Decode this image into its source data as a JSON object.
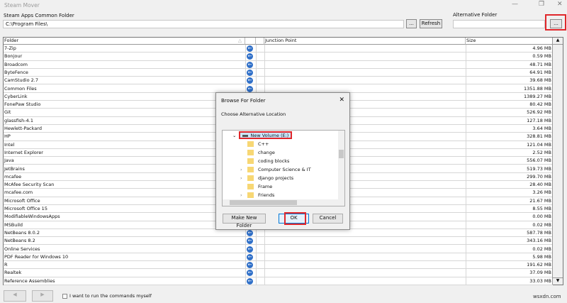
{
  "window": {
    "title": "Steam Mover",
    "min": "—",
    "restore": "❐",
    "close": "✕"
  },
  "steam": {
    "label": "Steam Apps Common Folder",
    "value": "C:\\Program Files\\",
    "browse": "...",
    "refresh": "Refresh"
  },
  "alt": {
    "label": "Alternative Folder",
    "value": "",
    "browse": "..."
  },
  "table": {
    "headers": {
      "folder": "Folder",
      "junction": "Junction Point",
      "size": "Size"
    },
    "rows": [
      {
        "folder": "7-Zip",
        "size": "4.96 MB"
      },
      {
        "folder": "Bonjour",
        "size": "0.59 MB"
      },
      {
        "folder": "Broadcom",
        "size": "48.71 MB"
      },
      {
        "folder": "ByteFence",
        "size": "64.91 MB"
      },
      {
        "folder": "CamStudio 2.7",
        "size": "39.68 MB"
      },
      {
        "folder": "Common Files",
        "size": "1351.88 MB"
      },
      {
        "folder": "CyberLink",
        "size": "1389.27 MB"
      },
      {
        "folder": "FonePaw Studio",
        "size": "80.42 MB"
      },
      {
        "folder": "Git",
        "size": "526.92 MB"
      },
      {
        "folder": "glassfish-4.1",
        "size": "127.18 MB"
      },
      {
        "folder": "Hewlett-Packard",
        "size": "3.64 MB"
      },
      {
        "folder": "HP",
        "size": "328.81 MB"
      },
      {
        "folder": "Intel",
        "size": "121.04 MB"
      },
      {
        "folder": "Internet Explorer",
        "size": "2.52 MB"
      },
      {
        "folder": "Java",
        "size": "556.07 MB"
      },
      {
        "folder": "JetBrains",
        "size": "519.73 MB"
      },
      {
        "folder": "mcafee",
        "size": "299.70 MB"
      },
      {
        "folder": "McAfee Security Scan",
        "size": "28.40 MB"
      },
      {
        "folder": "mcafee.com",
        "size": "3.26 MB"
      },
      {
        "folder": "Microsoft Office",
        "size": "21.67 MB"
      },
      {
        "folder": "Microsoft Office 15",
        "size": "8.55 MB"
      },
      {
        "folder": "ModifiableWindowsApps",
        "size": "0.00 MB"
      },
      {
        "folder": "MSBuild",
        "size": "0.02 MB"
      },
      {
        "folder": "NetBeans 8.0.2",
        "size": "587.78 MB"
      },
      {
        "folder": "NetBeans 8.2",
        "size": "343.16 MB"
      },
      {
        "folder": "Online Services",
        "size": "0.02 MB"
      },
      {
        "folder": "PDF Reader for Windows 10",
        "size": "5.98 MB"
      },
      {
        "folder": "R",
        "size": "191.62 MB"
      },
      {
        "folder": "Realtek",
        "size": "37.09 MB"
      },
      {
        "folder": "Reference Assemblies",
        "size": "33.03 MB"
      }
    ]
  },
  "bottom": {
    "checkbox_label": "I want to run the commands myself",
    "checked": false,
    "watermark": "wsxdn.com"
  },
  "dialog": {
    "title": "Browse For Folder",
    "close": "✕",
    "instruction": "Choose Alternative Location",
    "tree": [
      {
        "label": "New Volume (E:)",
        "expander": "⌄",
        "selected": true
      },
      {
        "label": "C++",
        "expander": ""
      },
      {
        "label": "change",
        "expander": ""
      },
      {
        "label": "coding blocks",
        "expander": ""
      },
      {
        "label": "Computer Science & IT",
        "expander": "›"
      },
      {
        "label": "django projects",
        "expander": "›"
      },
      {
        "label": "Frame",
        "expander": ""
      },
      {
        "label": "Friends",
        "expander": "›"
      }
    ],
    "make_new_folder": "Make New Folder",
    "ok": "OK",
    "cancel": "Cancel"
  },
  "colors": {
    "highlight": "#e0272b",
    "arrow_icon": "#2f6fc8"
  }
}
